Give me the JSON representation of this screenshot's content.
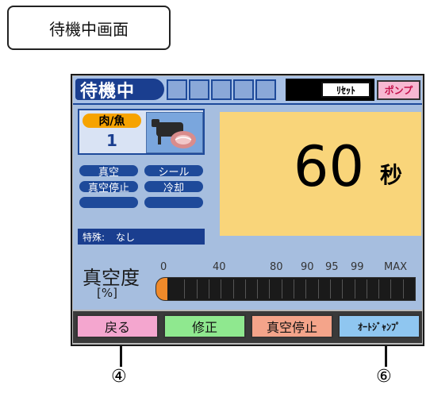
{
  "caption": "待機中画面",
  "status": {
    "state": "待機中",
    "reset_label": "ﾘｾｯﾄ",
    "pump_label": "ポンプ"
  },
  "mode": {
    "category": "肉/魚",
    "number": "1",
    "icon": "cow-meat-icon"
  },
  "options": [
    "真空",
    "シール",
    "真空停止",
    "冷却",
    "",
    ""
  ],
  "special": {
    "label": "特殊:",
    "value": "なし"
  },
  "timer": {
    "value": "60",
    "unit": "秒"
  },
  "vacuum": {
    "label": "真空度",
    "unit": "[%]",
    "ticks": [
      "0",
      "40",
      "80",
      "90",
      "95",
      "99",
      "MAX"
    ],
    "level_percent": 0
  },
  "buttons": {
    "back": "戻る",
    "edit": "修正",
    "vacuum_stop": "真空停止",
    "auto_jump": "ｵｰﾄｼﾞｬﾝﾌﾟ"
  },
  "callouts": [
    "④",
    "⑥"
  ],
  "colors": {
    "back": "#f4a6cf",
    "edit": "#8fe88f",
    "vacuum_stop": "#f4a48a",
    "auto_jump": "#8fc6f0",
    "timer_bg": "#f9d57a",
    "accent_blue": "#1a3e8f"
  }
}
